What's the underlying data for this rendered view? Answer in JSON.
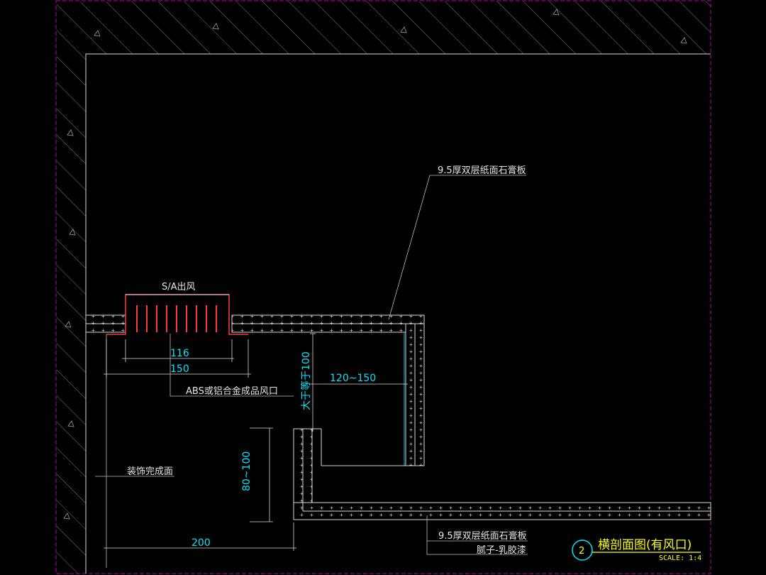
{
  "labels": {
    "board_top": "9.5厚双层纸面石膏板",
    "grille_top": "S/A出风",
    "grille_product": "ABS或铝合金成品风口",
    "finish_face": "装饰完成面",
    "board_bottom": "9.5厚双层纸面石膏板",
    "putty_paint": "腻子-乳胶漆"
  },
  "dimensions": {
    "d116": "116",
    "d150": "150",
    "d200": "200",
    "d120_150": "120~150",
    "d80_100": "80~100",
    "d_ge100": "大于等于100"
  },
  "title_block": {
    "number": "2",
    "title": "横剖面图(有风口)",
    "scale": "SCALE: 1:4"
  },
  "colors": {
    "background": "#000000",
    "linework": "#d8d8d8",
    "dimension_text": "#00e5ff",
    "title_text": "#ffff00",
    "grille": "#ff3b3b",
    "frame": "#b000b0"
  }
}
